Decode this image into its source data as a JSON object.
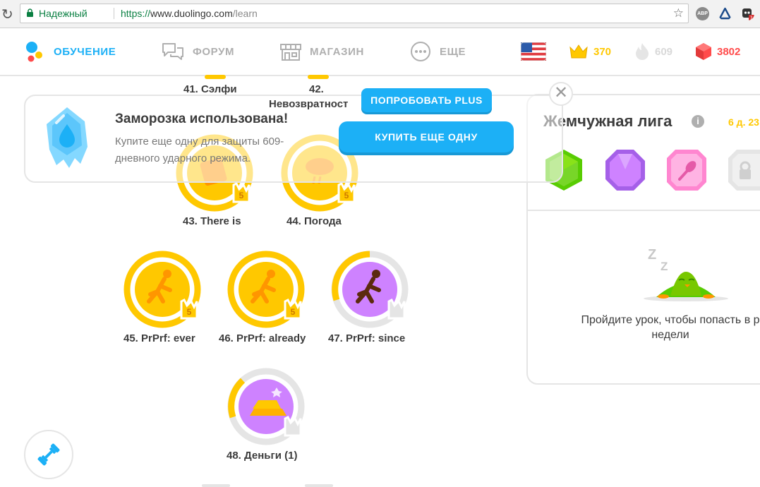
{
  "browser": {
    "secure_label": "Надежный",
    "url_scheme": "https://",
    "url_host": "www.duolingo.com",
    "url_path": "/learn",
    "abp_label": "ABP"
  },
  "nav": {
    "learn": "ОБУЧЕНИЕ",
    "forum": "ФОРУМ",
    "shop": "МАГАЗИН",
    "more": "ЕЩЕ"
  },
  "stats": {
    "crowns": "370",
    "streak": "609",
    "gems": "3802"
  },
  "skills": {
    "s41": "41. Сэлфи",
    "s42": "42.",
    "s43": "43. There is",
    "s44": "44. Погода",
    "s45": "45. PrPrf: ever",
    "s46": "46. PrPrf: already",
    "s47": "47. PrPrf: since",
    "s48": "48. Деньги (1)",
    "crown_level": "5"
  },
  "freeze": {
    "title": "Заморозка использована!",
    "description": "Купите еще одну для защиты 609-дневного ударного режима.",
    "nonrefundable": "Невозвратност",
    "try_plus": "ПОПРОБОВАТЬ PLUS",
    "buy_another": "КУПИТЬ ЕЩЕ ОДНУ"
  },
  "league": {
    "title": "Жемчужная лига",
    "time_left": "6 д. 23",
    "message": "Пройдите урок, чтобы попасть в р недели"
  },
  "colors": {
    "blue": "#1cb0f6",
    "gold": "#ffc800",
    "red": "#ff4b4b",
    "purple": "#ce82ff",
    "grey": "#afafaf"
  }
}
